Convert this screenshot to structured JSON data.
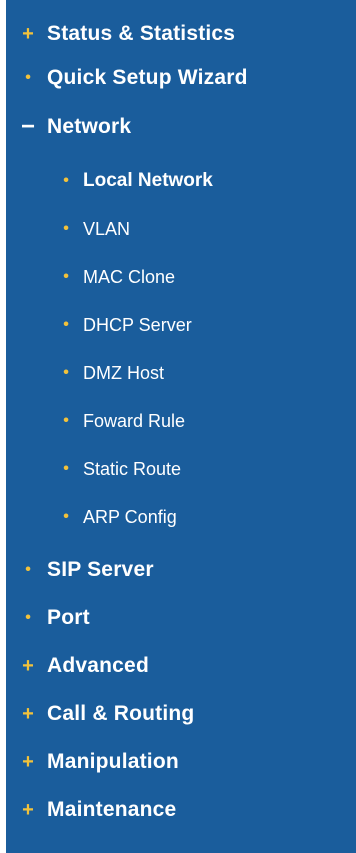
{
  "colors": {
    "sidebar_bg": "#1a5d9c",
    "marker": "#f2c23b",
    "text": "#ffffff"
  },
  "menu": {
    "status_statistics": {
      "marker": "+",
      "label": "Status & Statistics"
    },
    "quick_setup_wizard": {
      "marker": "•",
      "label": "Quick Setup Wizard"
    },
    "network": {
      "marker": "−",
      "label": "Network",
      "expanded": true,
      "children": {
        "local_network": {
          "marker": "•",
          "label": "Local Network",
          "active": true
        },
        "vlan": {
          "marker": "•",
          "label": "VLAN"
        },
        "mac_clone": {
          "marker": "•",
          "label": "MAC Clone"
        },
        "dhcp_server": {
          "marker": "•",
          "label": "DHCP Server"
        },
        "dmz_host": {
          "marker": "•",
          "label": "DMZ Host"
        },
        "foward_rule": {
          "marker": "•",
          "label": "Foward Rule"
        },
        "static_route": {
          "marker": "•",
          "label": "Static Route"
        },
        "arp_config": {
          "marker": "•",
          "label": "ARP Config"
        }
      }
    },
    "sip_server": {
      "marker": "•",
      "label": "SIP Server"
    },
    "port": {
      "marker": "•",
      "label": "Port"
    },
    "advanced": {
      "marker": "+",
      "label": "Advanced"
    },
    "call_routing": {
      "marker": "+",
      "label": "Call & Routing"
    },
    "manipulation": {
      "marker": "+",
      "label": "Manipulation"
    },
    "maintenance": {
      "marker": "+",
      "label": "Maintenance"
    }
  }
}
